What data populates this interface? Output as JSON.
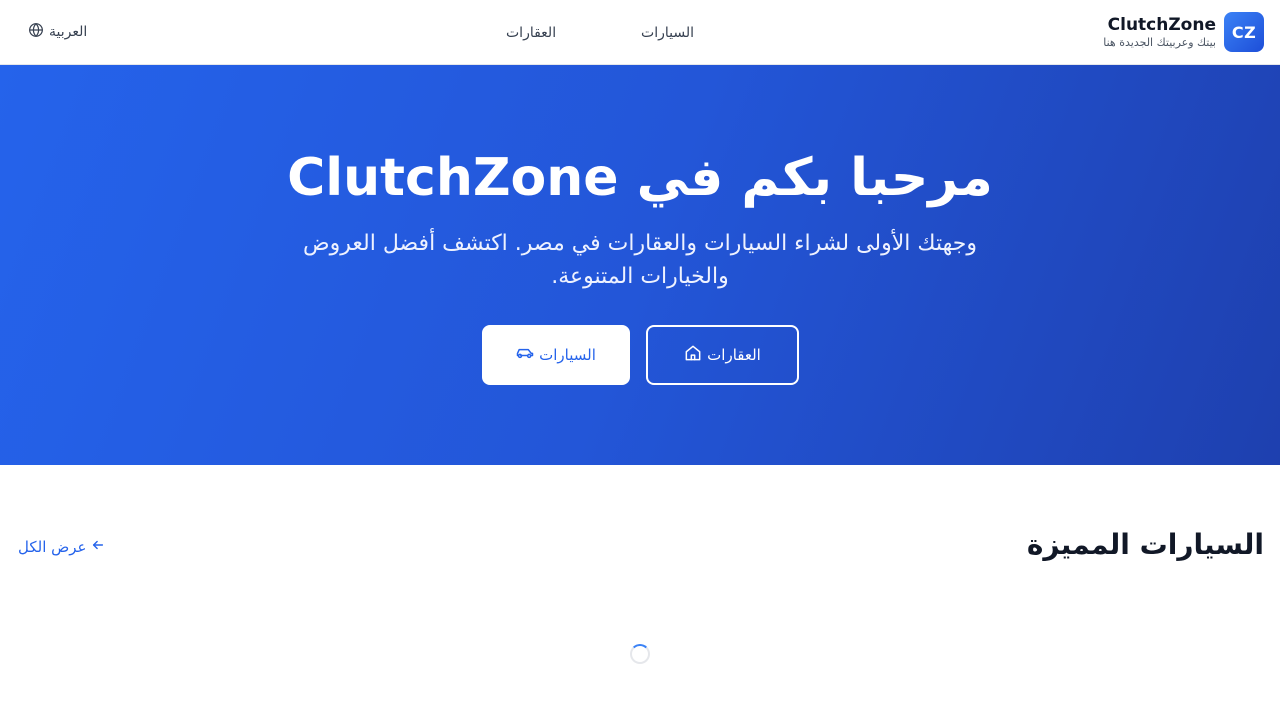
{
  "header": {
    "logo_text": "CZ",
    "brand_name": "ClutchZone",
    "tagline": "بيتك وعربيتك الجديدة هنا",
    "nav": [
      {
        "label": "السيارات"
      },
      {
        "label": "العقارات"
      }
    ],
    "language_label": "العربية",
    "language_icon": "globe-icon"
  },
  "hero": {
    "title": "مرحبا بكم في ClutchZone",
    "subtitle": "وجهتك الأولى لشراء السيارات والعقارات في مصر. اكتشف أفضل العروض والخيارات المتنوعة.",
    "buttons": {
      "cars_label": "السيارات",
      "cars_icon": "car-icon",
      "properties_label": "العقارات",
      "properties_icon": "house-icon"
    }
  },
  "featured": {
    "title": "السيارات المميزة",
    "view_all_label": "عرض الكل",
    "view_all_icon": "arrow-left-icon"
  },
  "colors": {
    "accent": "#2563eb",
    "hero_gradient_start": "#2563eb",
    "hero_gradient_end": "#1e40af",
    "text_dark": "#111827"
  }
}
